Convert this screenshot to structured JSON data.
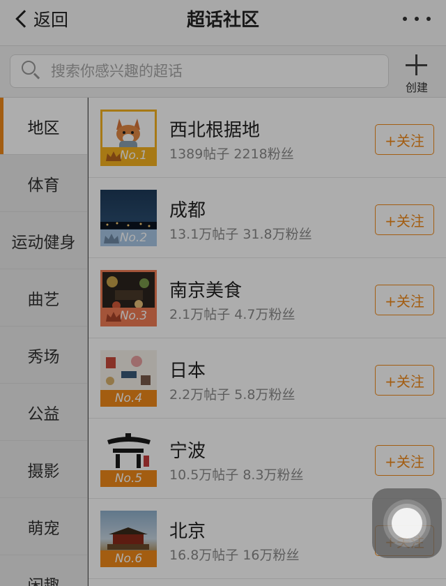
{
  "header": {
    "back_label": "返回",
    "title": "超话社区"
  },
  "search": {
    "placeholder": "搜索你感兴趣的超话",
    "value": ""
  },
  "create": {
    "label": "创建"
  },
  "sidebar": {
    "items": [
      {
        "label": "地区",
        "active": true
      },
      {
        "label": "体育"
      },
      {
        "label": "运动健身"
      },
      {
        "label": "曲艺"
      },
      {
        "label": "秀场"
      },
      {
        "label": "公益"
      },
      {
        "label": "摄影"
      },
      {
        "label": "萌宠"
      },
      {
        "label": "闲趣"
      }
    ]
  },
  "list": {
    "follow_label": "+关注",
    "items": [
      {
        "title": "西北根据地",
        "stats": "1389帖子 2218粉丝",
        "rank": "No.1",
        "badge_color": "#f6b320"
      },
      {
        "title": "成都",
        "stats": "13.1万帖子 31.8万粉丝",
        "rank": "No.2",
        "badge_color": "#a9c8e6"
      },
      {
        "title": "南京美食",
        "stats": "2.1万帖子 4.7万粉丝",
        "rank": "No.3",
        "badge_color": "#f07d54"
      },
      {
        "title": "日本",
        "stats": "2.2万帖子 5.8万粉丝",
        "rank": "No.4",
        "badge_color": "#f08a1a"
      },
      {
        "title": "宁波",
        "stats": "10.5万帖子 8.3万粉丝",
        "rank": "No.5",
        "badge_color": "#f08a1a"
      },
      {
        "title": "北京",
        "stats": "16.8万帖子 16万粉丝",
        "rank": "No.6",
        "badge_color": "#f08a1a"
      }
    ]
  },
  "colors": {
    "accent": "#f08a1a"
  }
}
